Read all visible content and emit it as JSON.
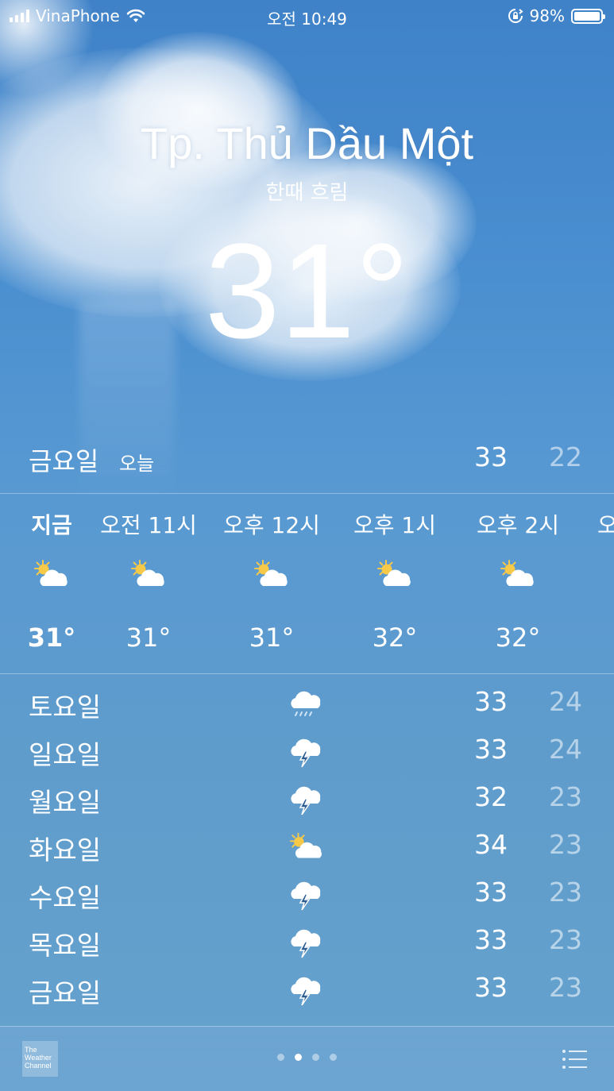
{
  "status": {
    "carrier": "VinaPhone",
    "time": "오전 10:49",
    "battery": "98%"
  },
  "header": {
    "city": "Tp. Thủ Dầu Một",
    "condition": "한때 흐림",
    "temperature": "31°"
  },
  "today": {
    "day": "금요일",
    "tag": "오늘",
    "high": "33",
    "low": "22"
  },
  "hourly": [
    {
      "label": "지금",
      "icon": "partly-sunny-icon",
      "temp": "31°"
    },
    {
      "label": "오전 11시",
      "icon": "partly-sunny-icon",
      "temp": "31°"
    },
    {
      "label": "오후 12시",
      "icon": "partly-sunny-icon",
      "temp": "31°"
    },
    {
      "label": "오후 1시",
      "icon": "partly-sunny-icon",
      "temp": "32°"
    },
    {
      "label": "오후 2시",
      "icon": "partly-sunny-icon",
      "temp": "32°"
    },
    {
      "label": "오",
      "icon": "",
      "temp": ""
    }
  ],
  "daily": [
    {
      "day": "토요일",
      "icon": "rain-icon",
      "high": "33",
      "low": "24"
    },
    {
      "day": "일요일",
      "icon": "thunderstorm-icon",
      "high": "33",
      "low": "24"
    },
    {
      "day": "월요일",
      "icon": "thunderstorm-icon",
      "high": "32",
      "low": "23"
    },
    {
      "day": "화요일",
      "icon": "partly-sunny-icon",
      "high": "34",
      "low": "23"
    },
    {
      "day": "수요일",
      "icon": "thunderstorm-icon",
      "high": "33",
      "low": "23"
    },
    {
      "day": "목요일",
      "icon": "thunderstorm-icon",
      "high": "33",
      "low": "23"
    },
    {
      "day": "금요일",
      "icon": "thunderstorm-icon",
      "high": "33",
      "low": "23"
    }
  ],
  "footer": {
    "logo_lines": [
      "The",
      "Weather",
      "Channel"
    ],
    "page_count": 4,
    "active_page": 1
  }
}
